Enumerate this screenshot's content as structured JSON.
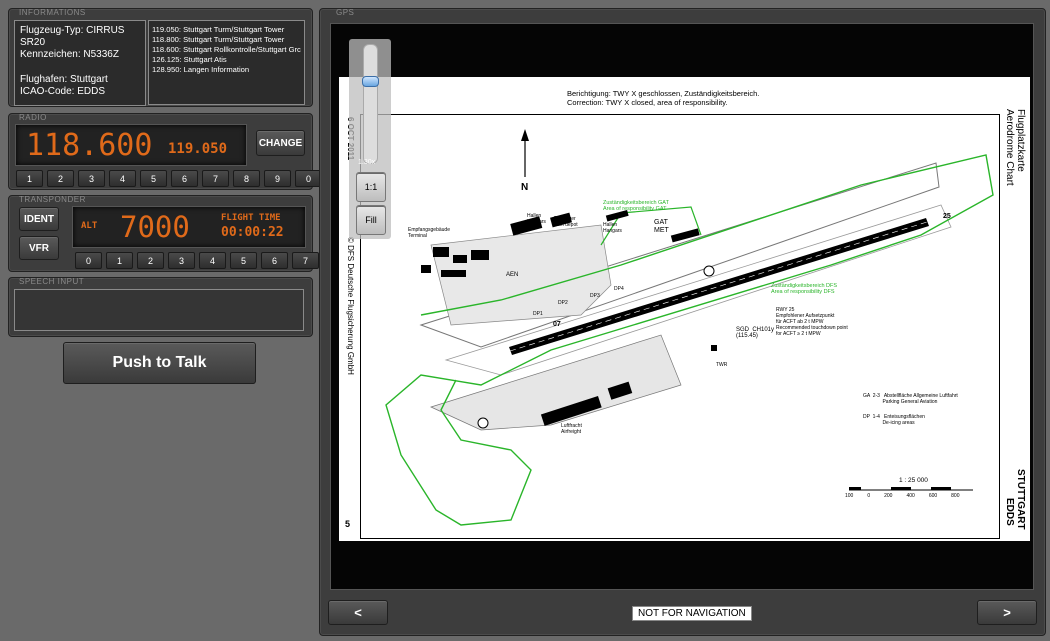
{
  "info": {
    "title": "INFORMATIONS",
    "lines": "Flugzeug-Typ: CIRRUS SR20\nKennzeichen: N5336Z\n\nFlughafen: Stuttgart\nICAO-Code: EDDS",
    "frequencies": [
      "119.050: Stuttgart Turm/Stuttgart Tower",
      "118.800: Stuttgart Turm/Stuttgart Tower",
      "118.600: Stuttgart Rollkontrolle/Stuttgart Grc",
      "126.125: Stuttgart Atis",
      "128.950: Langen Information"
    ]
  },
  "radio": {
    "title": "RADIO",
    "active": "118.600",
    "standby": "119.050",
    "change_label": "CHANGE",
    "keys": [
      "1",
      "2",
      "3",
      "4",
      "5",
      "6",
      "7",
      "8",
      "9",
      "0"
    ]
  },
  "transponder": {
    "title": "TRANSPONDER",
    "ident_label": "IDENT",
    "vfr_label": "VFR",
    "mode": "ALT",
    "code": "7000",
    "flight_time_label": "FLIGHT TIME",
    "flight_time": "00:00:22",
    "keys": [
      "0",
      "1",
      "2",
      "3",
      "4",
      "5",
      "6",
      "7"
    ]
  },
  "speech": {
    "title": "SPEECH INPUT",
    "value": ""
  },
  "ptt_label": "Push to Talk",
  "gps": {
    "title": "GPS",
    "zoom": "1.30x",
    "zoom_level": 0.8,
    "btn_1to1": "1:1",
    "btn_fill": "Fill",
    "prev_label": "<",
    "next_label": ">",
    "notice": "NOT FOR NAVIGATION"
  },
  "chart": {
    "correction_de": "Berichtigung:  TWY X geschlossen, Zuständigkeitsbereich.",
    "correction_en": "Correction:      TWY X closed, area of responsibility.",
    "date": "6 OCT 2011",
    "publisher": "© DFS Deutsche Flugsicherung GmbH",
    "page_no": "5",
    "title_de": "Flugplatzkarte",
    "title_en": "Aerodrome Chart",
    "city": "STUTTGART",
    "icao": "EDDS",
    "north": "N",
    "scale": "1 : 25 000",
    "scale_ticks": [
      "100",
      "0",
      "200",
      "400",
      "600",
      "800"
    ],
    "gat_label": "GAT\nMET",
    "labels": {
      "empfang": "Empfangsgebäude\nTerminal",
      "hallen1": "Hallen\nHangars",
      "tank": "Tanklager\nFuel depot",
      "hallen2": "Hallen\nHangars",
      "area_gat": "Zuständigkeitsbereich GAT\nArea of responsibility GAT",
      "area_gat2": "Zuständigkeitsbereich DFS\nArea of responsibility DFS",
      "rwy_note": "RWY 25\nEmpfohlener Aufsetzpunkt\nfür ACFT ab 2 t MPW\nRecommended touchdown point\nfor ACFT ≥ 2 t MPW",
      "ga_legend": "GA  2-3   Abstellfläche Allgemeine Luftfahrt\n              Parking General Aviation",
      "dp_legend": "DP  1-4   Enteisungsflächen\n              De-icing areas",
      "sgd": "SGD  CH101y\n(115.45)",
      "twr": "TWR",
      "aen": "AEN",
      "luftfracht": "Luftfracht\nAirfreight",
      "rwy07": "07",
      "rwy25": "25",
      "dp1": "DP1",
      "dp2": "DP2",
      "dp3": "DP3",
      "dp4": "DP4"
    }
  }
}
